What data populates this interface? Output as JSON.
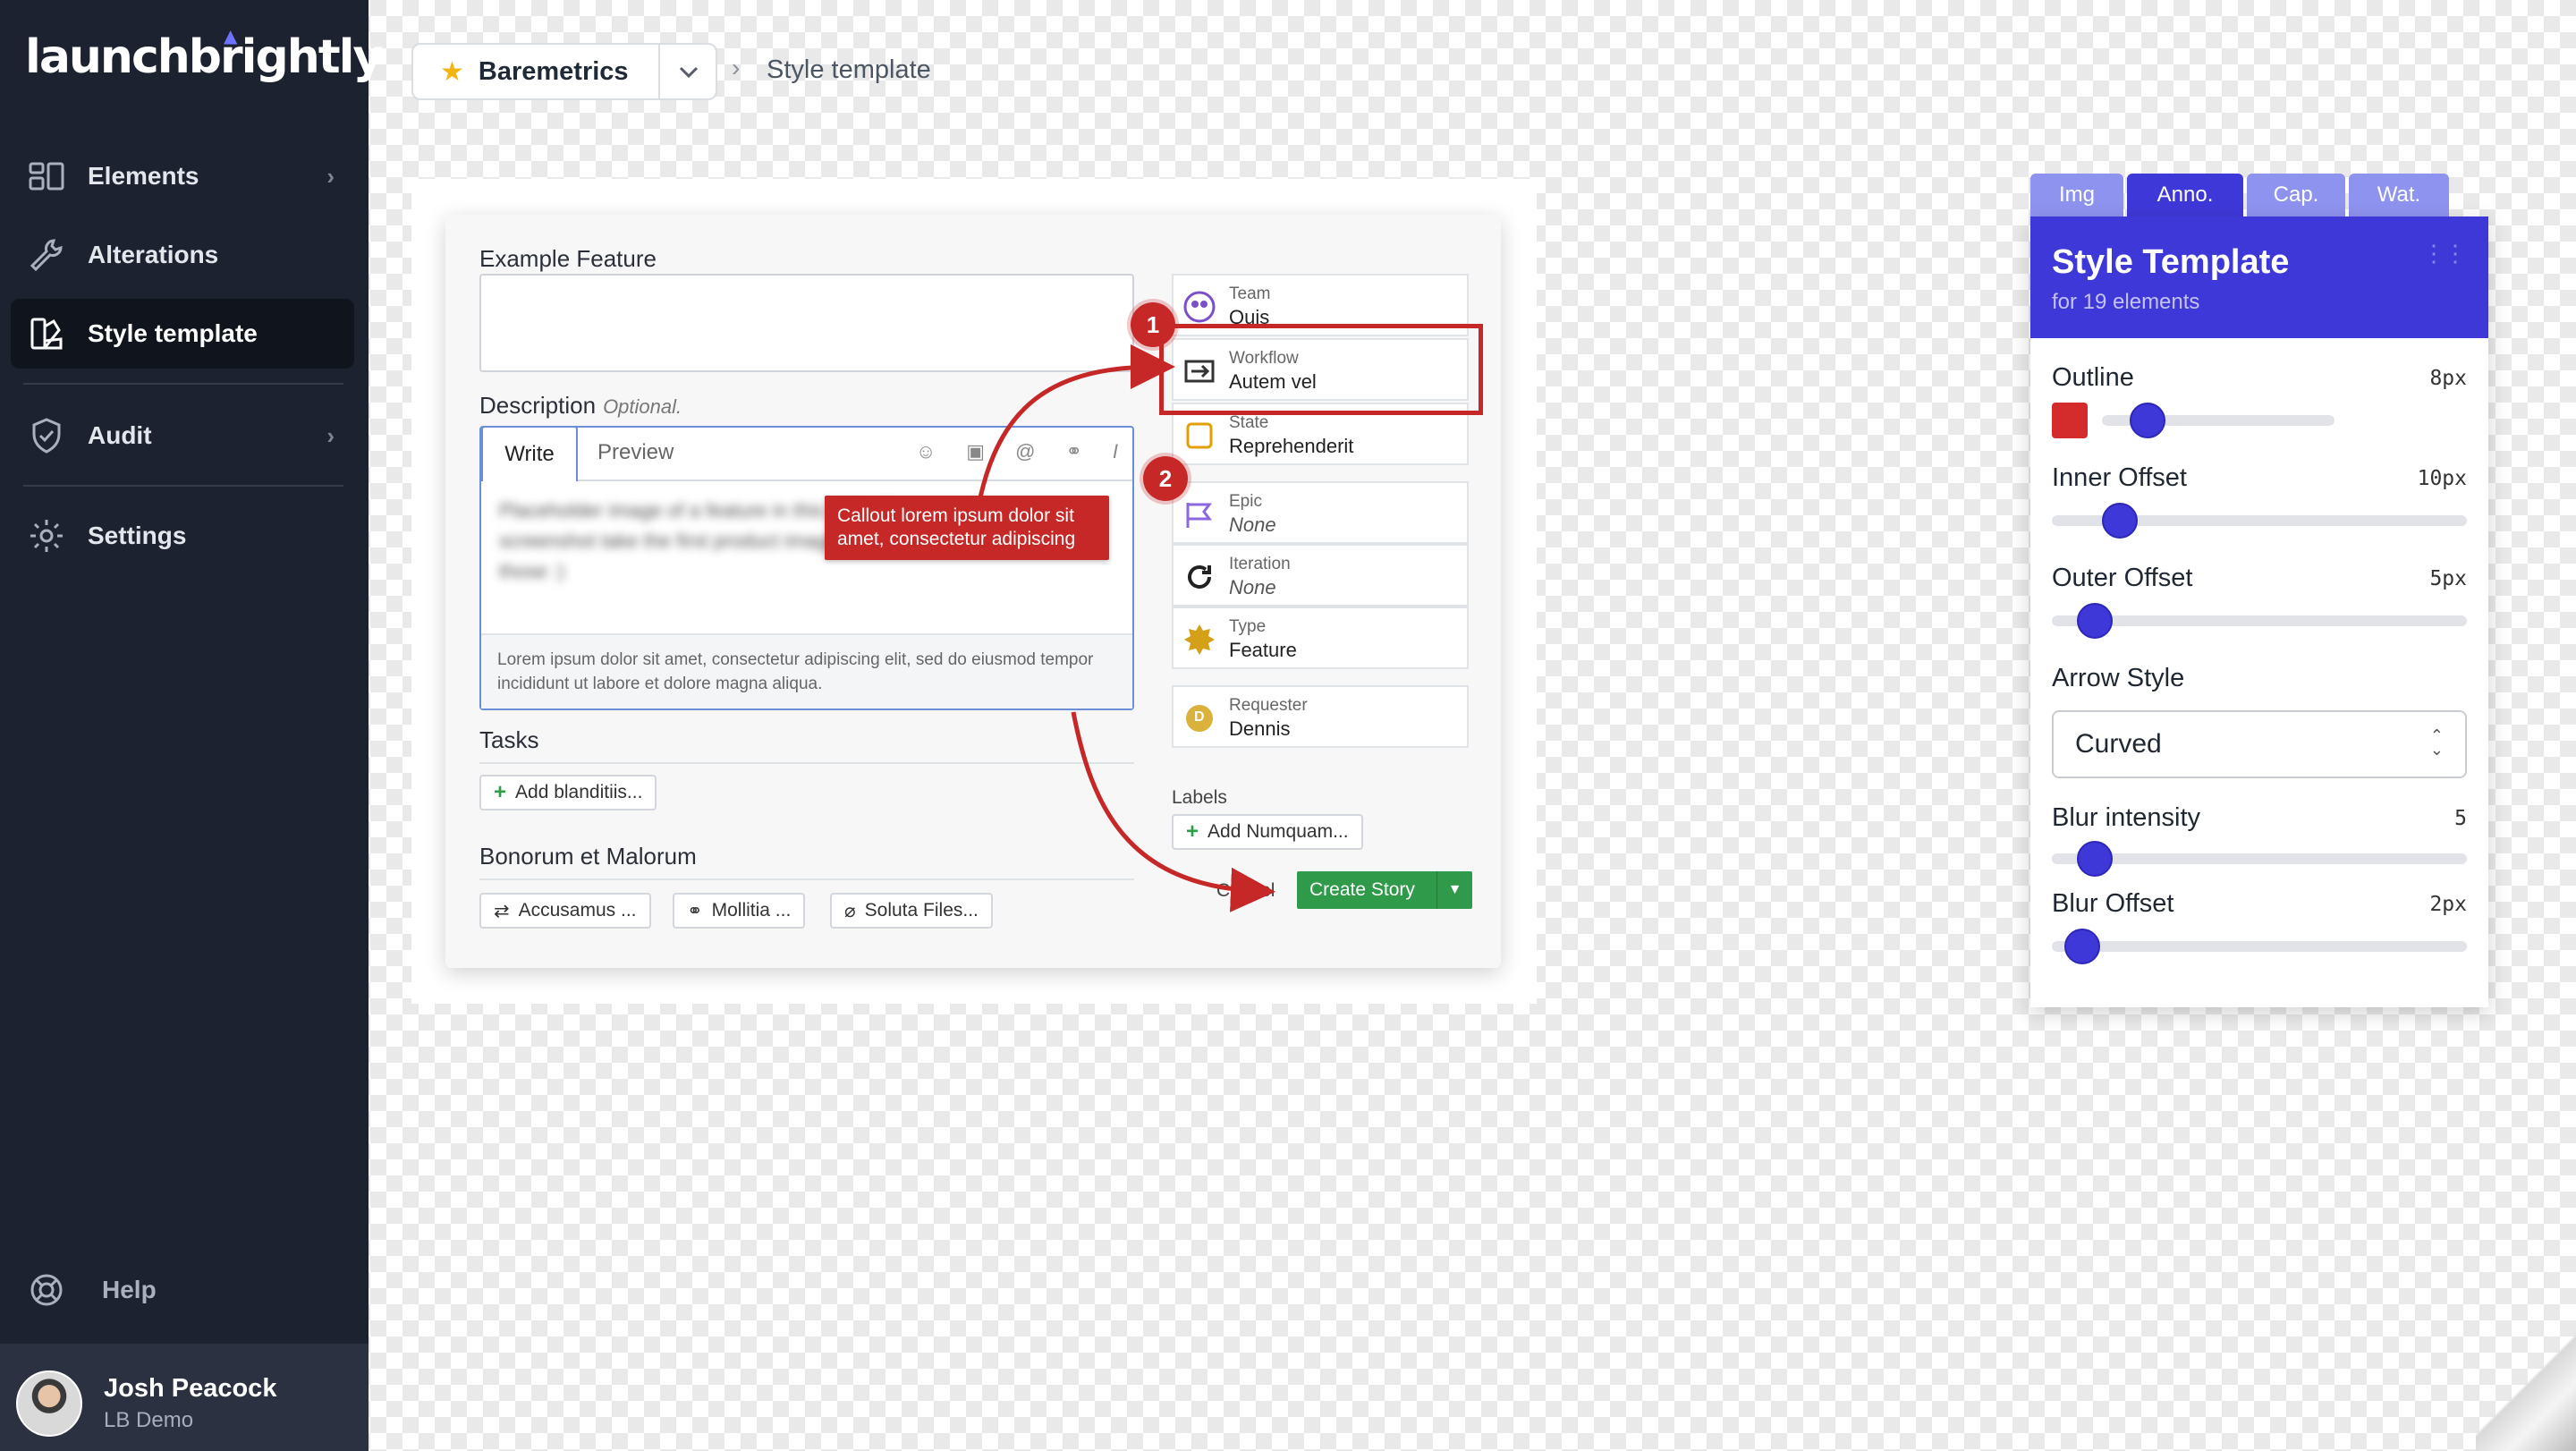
{
  "app": {
    "logo": "launchbrightly"
  },
  "sidebar": {
    "items": [
      {
        "label": "Elements",
        "icon": "layout-icon",
        "has_chevron": true
      },
      {
        "label": "Alterations",
        "icon": "wrench-icon",
        "has_chevron": false
      },
      {
        "label": "Style template",
        "icon": "palette-icon",
        "has_chevron": false,
        "active": true
      },
      {
        "label": "Audit",
        "icon": "shield-icon",
        "has_chevron": true
      },
      {
        "label": "Settings",
        "icon": "gear-icon",
        "has_chevron": false
      }
    ],
    "help": "Help",
    "user": {
      "name": "Josh Peacock",
      "org": "LB Demo"
    }
  },
  "breadcrumb": {
    "project": "Baremetrics",
    "page": "Style template"
  },
  "preview": {
    "feature_label": "Example Feature",
    "description_label": "Description",
    "optional": "Optional.",
    "tab_write": "Write",
    "tab_preview": "Preview",
    "placeholder_blurred": "Placeholder image of a feature in this style. Once you've run a screenshot take the first product images, you can flip through those :)",
    "editor_footer": "Lorem ipsum dolor sit amet, consectetur adipiscing elit, sed do eiusmod tempor incididunt ut labore et dolore magna aliqua.",
    "callout": "Callout lorem ipsum dolor sit amet, consectetur adipiscing",
    "tasks_label": "Tasks",
    "add_task": "Add blanditiis...",
    "section2_label": "Bonorum et Malorum",
    "attachments": [
      "Accusamus ...",
      "Mollitia ...",
      "Soluta Files..."
    ],
    "fields": [
      {
        "key": "Team",
        "value": "Quis"
      },
      {
        "key": "Workflow",
        "value": "Autem vel"
      },
      {
        "key": "State",
        "value": "Reprehenderit"
      },
      {
        "key": "Epic",
        "value": "None"
      },
      {
        "key": "Iteration",
        "value": "None"
      },
      {
        "key": "Type",
        "value": "Feature"
      },
      {
        "key": "Requester",
        "value": "Dennis",
        "avatar_letter": "D"
      }
    ],
    "labels_label": "Labels",
    "add_label": "Add Numquam...",
    "cancel": "Cancel",
    "create": "Create Story",
    "badges": [
      "1",
      "2"
    ],
    "annotation_color": "#c62828"
  },
  "panel": {
    "tabs": [
      {
        "label": "Img",
        "active": false
      },
      {
        "label": "Anno.",
        "active": true
      },
      {
        "label": "Cap.",
        "active": false
      },
      {
        "label": "Wat.",
        "active": false
      }
    ],
    "title": "Style Template",
    "subtitle": "for 19 elements",
    "accent": "#3f38d9",
    "controls": {
      "outline": {
        "label": "Outline",
        "value": "8px",
        "level": 0.12,
        "color": "#d42c2c"
      },
      "inner_offset": {
        "label": "Inner Offset",
        "value": "10px",
        "level": 0.12
      },
      "outer_offset": {
        "label": "Outer Offset",
        "value": "5px",
        "level": 0.06
      },
      "arrow_style": {
        "label": "Arrow Style",
        "value": "Curved"
      },
      "blur_intensity": {
        "label": "Blur intensity",
        "value": "5",
        "level": 0.06
      },
      "blur_offset": {
        "label": "Blur Offset",
        "value": "2px",
        "level": 0.03
      }
    }
  }
}
